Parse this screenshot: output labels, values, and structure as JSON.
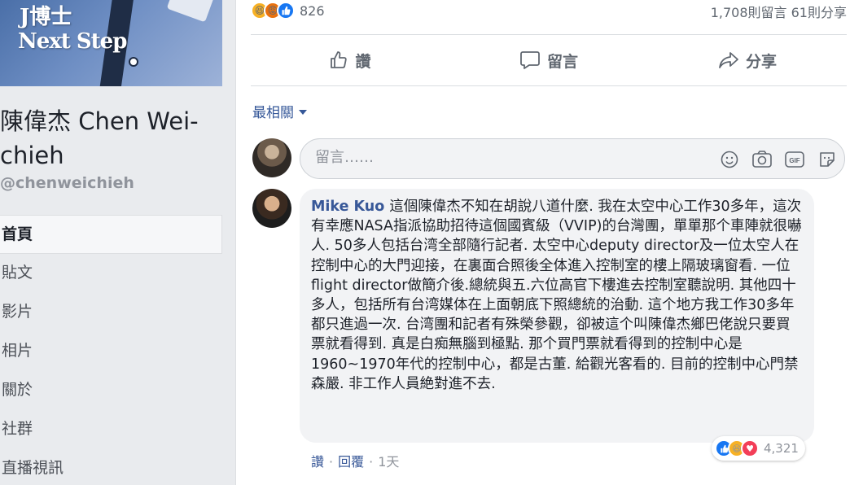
{
  "left": {
    "cover": {
      "line1": "J博士",
      "line2": "Next Step"
    },
    "page_name": "陳偉杰 Chen Wei-chieh",
    "page_handle": "@chenweichieh",
    "nav": [
      {
        "label": "首頁",
        "active": true
      },
      {
        "label": "貼文"
      },
      {
        "label": "影片"
      },
      {
        "label": "相片"
      },
      {
        "label": "關於"
      },
      {
        "label": "社群"
      },
      {
        "label": "直播視訊"
      }
    ]
  },
  "post": {
    "reaction_count": "826",
    "reaction_icons": [
      "haha-icon",
      "angry-icon",
      "like-icon"
    ],
    "comment_share_counts": "1,708則留言 61則分享",
    "actions": {
      "like": "讚",
      "comment": "留言",
      "share": "分享"
    },
    "sort_label": "最相關",
    "compose_placeholder": "留言……"
  },
  "comment": {
    "author": "Mike Kuo",
    "text": "這個陳偉杰不知在胡說八道什麼. 我在太空中心工作30多年，這次有幸應NASA指派協助招待這個國賓級（VVIP)的台灣團，單單那个車陣就很嚇人. 50多人包括台湾全部隨行記者. 太空中心deputy director及一位太空人在控制中心的大門迎接，在裏面合照後全体進入控制室的樓上隔玻璃窗看. 一位flight director做簡介後.總統與五.六位高官下樓進去控制室聽說明. 其他四十多人，包括所有台湾媒体在上面朝底下照總統的治動. 這个地方我工作30多年都只進過一次. 台湾團和記者有殊榮參觀，卻被這个叫陳偉杰鄉巴佬說只要買票就看得到. 真是白痴無腦到極點. 那个買門票就看得到的控制中心是1960~1970年代的控制中心，都是古董. 給觀光客看的. 目前的控制中心門禁森嚴. 非工作人員絶對進不去.",
    "reaction_count": "4,321",
    "actions": {
      "like": "讚",
      "reply": "回覆",
      "time": "1天",
      "sep": "·"
    }
  },
  "colors": {
    "link": "#385898",
    "like_blue": "#1877f2",
    "bg": "#e9ebee"
  }
}
